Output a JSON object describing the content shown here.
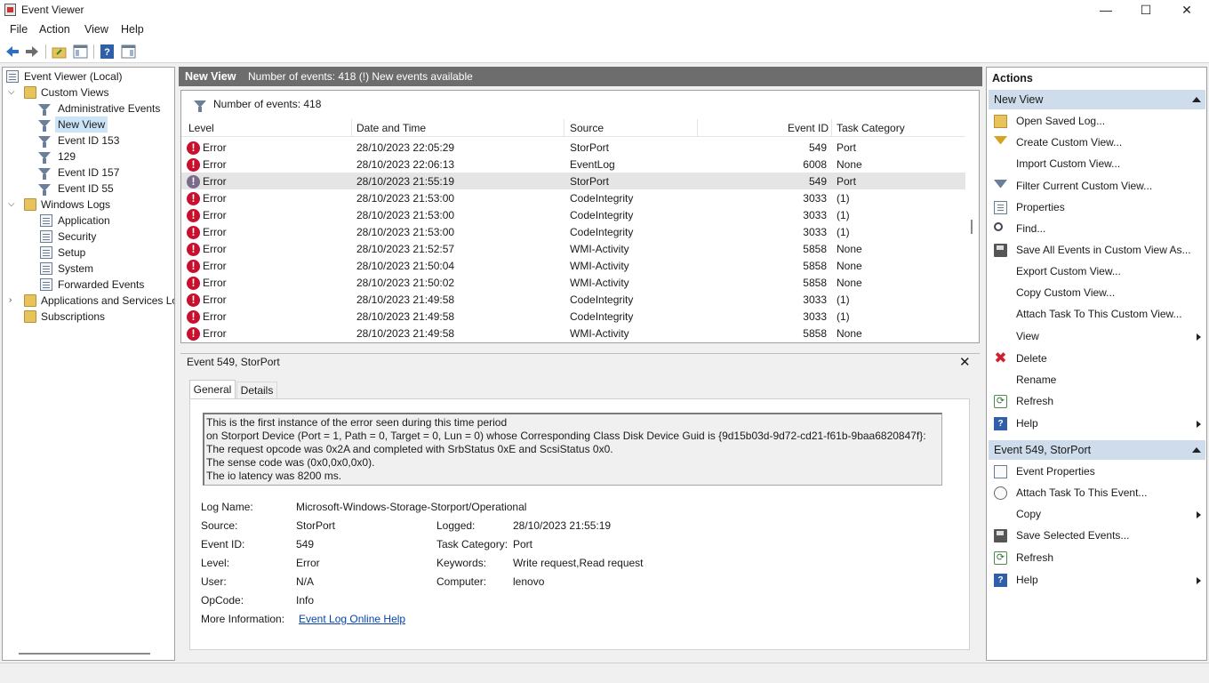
{
  "window": {
    "title": "Event Viewer",
    "controls": {
      "minimize": "—",
      "maximize": "☐",
      "close": "✕"
    }
  },
  "menu": [
    "File",
    "Action",
    "View",
    "Help"
  ],
  "tree": {
    "root": "Event Viewer (Local)",
    "custom_views": "Custom Views",
    "custom_items": [
      "Administrative Events",
      "New View",
      "Event ID 153",
      "129",
      "Event ID 157",
      "Event ID 55"
    ],
    "windows_logs": "Windows Logs",
    "windows_items": [
      "Application",
      "Security",
      "Setup",
      "System",
      "Forwarded Events"
    ],
    "apps_services": "Applications and Services Lo",
    "subscriptions": "Subscriptions"
  },
  "center": {
    "title": "New View",
    "subtitle": "Number of events: 418 (!) New events available",
    "count_label": "Number of events: 418",
    "columns": [
      "Level",
      "Date and Time",
      "Source",
      "Event ID",
      "Task Category"
    ],
    "rows": [
      {
        "level": "Error",
        "date": "28/10/2023 22:05:29",
        "source": "StorPort",
        "id": "549",
        "cat": "Port"
      },
      {
        "level": "Error",
        "date": "28/10/2023 22:06:13",
        "source": "EventLog",
        "id": "6008",
        "cat": "None"
      },
      {
        "level": "Error",
        "date": "28/10/2023 21:55:19",
        "source": "StorPort",
        "id": "549",
        "cat": "Port"
      },
      {
        "level": "Error",
        "date": "28/10/2023 21:53:00",
        "source": "CodeIntegrity",
        "id": "3033",
        "cat": "(1)"
      },
      {
        "level": "Error",
        "date": "28/10/2023 21:53:00",
        "source": "CodeIntegrity",
        "id": "3033",
        "cat": "(1)"
      },
      {
        "level": "Error",
        "date": "28/10/2023 21:53:00",
        "source": "CodeIntegrity",
        "id": "3033",
        "cat": "(1)"
      },
      {
        "level": "Error",
        "date": "28/10/2023 21:52:57",
        "source": "WMI-Activity",
        "id": "5858",
        "cat": "None"
      },
      {
        "level": "Error",
        "date": "28/10/2023 21:50:04",
        "source": "WMI-Activity",
        "id": "5858",
        "cat": "None"
      },
      {
        "level": "Error",
        "date": "28/10/2023 21:50:02",
        "source": "WMI-Activity",
        "id": "5858",
        "cat": "None"
      },
      {
        "level": "Error",
        "date": "28/10/2023 21:49:58",
        "source": "CodeIntegrity",
        "id": "3033",
        "cat": "(1)"
      },
      {
        "level": "Error",
        "date": "28/10/2023 21:49:58",
        "source": "CodeIntegrity",
        "id": "3033",
        "cat": "(1)"
      },
      {
        "level": "Error",
        "date": "28/10/2023 21:49:58",
        "source": "WMI-Activity",
        "id": "5858",
        "cat": "None"
      }
    ],
    "selected_row": 2
  },
  "detail": {
    "title": "Event 549, StorPort",
    "close": "✕",
    "tabs": [
      "General",
      "Details"
    ],
    "description": [
      "This is the first instance of the error seen during this time period",
      "on Storport Device (Port = 1, Path = 0, Target = 0, Lun = 0) whose Corresponding Class Disk Device Guid is {9d15b03d-9d72-cd21-f61b-9baa6820847f}:",
      "The request opcode was 0x2A and completed with SrbStatus 0xE and ScsiStatus 0x0.",
      "The sense code was (0x0,0x0,0x0).",
      "The io latency was 8200 ms."
    ],
    "labels": {
      "log_name": "Log Name:",
      "source": "Source:",
      "event_id": "Event ID:",
      "level": "Level:",
      "user": "User:",
      "opcode": "OpCode:",
      "more_info": "More Information:",
      "logged": "Logged:",
      "task_category": "Task Category:",
      "keywords": "Keywords:",
      "computer": "Computer:"
    },
    "values": {
      "log_name": "Microsoft-Windows-Storage-Storport/Operational",
      "source": "StorPort",
      "event_id": "549",
      "level": "Error",
      "user": "N/A",
      "opcode": "Info",
      "more_info": "Event Log Online Help",
      "logged": "28/10/2023 21:55:19",
      "task_category": "Port",
      "keywords": "Write request,Read request",
      "computer": "lenovo"
    }
  },
  "actions": {
    "header": "Actions",
    "section1": "New View",
    "items1": [
      "Open Saved Log...",
      "Create Custom View...",
      "Import Custom View...",
      "Filter Current Custom View...",
      "Properties",
      "Find...",
      "Save All Events in Custom View As...",
      "Export Custom View...",
      "Copy Custom View...",
      "Attach Task To This Custom View...",
      "View",
      "Delete",
      "Rename",
      "Refresh",
      "Help"
    ],
    "section2": "Event 549, StorPort",
    "items2": [
      "Event Properties",
      "Attach Task To This Event...",
      "Copy",
      "Save Selected Events...",
      "Refresh",
      "Help"
    ]
  }
}
